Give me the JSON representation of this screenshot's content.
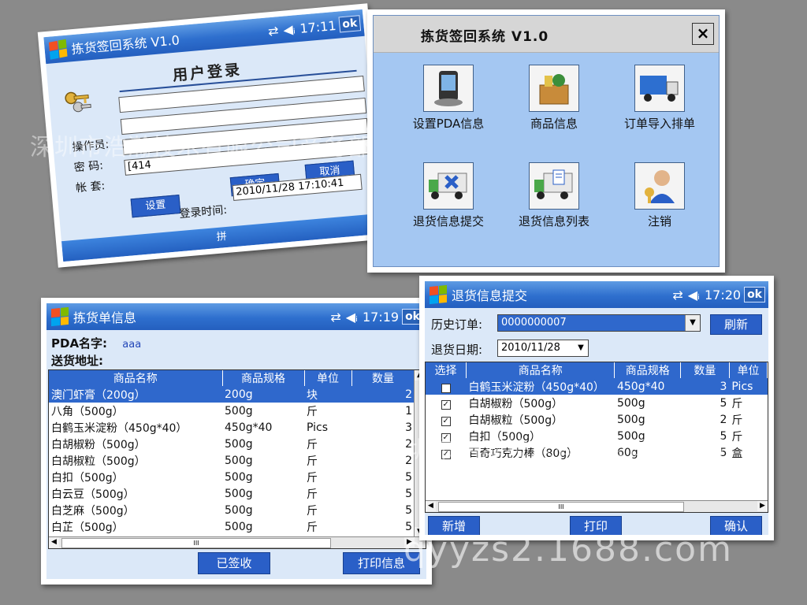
{
  "login": {
    "title": "拣货签回系统 V1.0",
    "time": "17:11",
    "ok": "ok",
    "heading": "用户登录",
    "operator_label": "操作员:",
    "operator_value": "",
    "password_label": "密 码:",
    "password_value": "",
    "account_label": "帐 套:",
    "account_value": "[414",
    "settings_button": "设置",
    "confirm_button": "确定",
    "cancel_button": "取消",
    "login_time_label": "登录时间:",
    "login_time_value": "2010/11/28 17:10:41",
    "footer": "拼"
  },
  "menu": {
    "title": "拣货签回系统 V1.0",
    "close": "×",
    "items": [
      {
        "label": "设置PDA信息",
        "icon": "pda-device-icon"
      },
      {
        "label": "商品信息",
        "icon": "goods-box-icon"
      },
      {
        "label": "订单导入排单",
        "icon": "delivery-truck-icon"
      },
      {
        "label": "退货信息提交",
        "icon": "return-truck-icon"
      },
      {
        "label": "退货信息列表",
        "icon": "return-list-truck-icon"
      },
      {
        "label": "注销",
        "icon": "user-logout-icon"
      }
    ]
  },
  "picklist": {
    "title": "拣货单信息",
    "time": "17:19",
    "ok": "ok",
    "pda_name_label": "PDA名字:",
    "pda_name_value": "aaa",
    "address_label": "送货地址:",
    "columns": [
      "商品名称",
      "商品规格",
      "单位",
      "数量"
    ],
    "rows": [
      {
        "name": "澳门虾膏（200g）",
        "spec": "200g",
        "unit": "块",
        "qty": "2"
      },
      {
        "name": "八角（500g）",
        "spec": "500g",
        "unit": "斤",
        "qty": "1"
      },
      {
        "name": "白鹤玉米淀粉（450g*40）",
        "spec": "450g*40",
        "unit": "Pics",
        "qty": "3"
      },
      {
        "name": "白胡椒粉（500g）",
        "spec": "500g",
        "unit": "斤",
        "qty": "2"
      },
      {
        "name": "白胡椒粒（500g）",
        "spec": "500g",
        "unit": "斤",
        "qty": "2"
      },
      {
        "name": "白扣（500g）",
        "spec": "500g",
        "unit": "斤",
        "qty": "5"
      },
      {
        "name": "白云豆（500g）",
        "spec": "500g",
        "unit": "斤",
        "qty": "5"
      },
      {
        "name": "白芝麻（500g）",
        "spec": "500g",
        "unit": "斤",
        "qty": "5"
      },
      {
        "name": "白芷（500g）",
        "spec": "500g",
        "unit": "斤",
        "qty": "5"
      }
    ],
    "signed_button": "已签收",
    "print_button": "打印信息"
  },
  "returns": {
    "title": "退货信息提交",
    "time": "17:20",
    "ok": "ok",
    "history_label": "历史订单:",
    "history_value": "0000000007",
    "refresh_button": "刷新",
    "date_label": "退货日期:",
    "date_value": "2010/11/28",
    "columns": [
      "选择",
      "商品名称",
      "商品规格",
      "数量",
      "单位"
    ],
    "rows": [
      {
        "name": "白鹤玉米淀粉（450g*40）",
        "spec": "450g*40",
        "qty": "3",
        "unit": "Pics"
      },
      {
        "name": "白胡椒粉（500g）",
        "spec": "500g",
        "qty": "5",
        "unit": "斤"
      },
      {
        "name": "白胡椒粒（500g）",
        "spec": "500g",
        "qty": "2",
        "unit": "斤"
      },
      {
        "name": "白扣（500g）",
        "spec": "500g",
        "qty": "5",
        "unit": "斤"
      },
      {
        "name": "百奇巧克力棒（80g）",
        "spec": "60g",
        "qty": "5",
        "unit": "盒"
      }
    ],
    "new_button": "新增",
    "print_button": "打印",
    "confirm_button": "确认"
  },
  "watermarks": {
    "company_1": "深圳市浩瀚技术有限公司商务部",
    "company_2": "深圳市浩瀚技术有限公司商务部",
    "url": "qyyzs2.1688.com"
  },
  "colors": {
    "title_bar": "#2e6fce",
    "selection": "#2f68cc",
    "button": "#2a5fc7",
    "screen_bg": "#dbe8f8",
    "menu_bg": "#a4c7f2"
  }
}
